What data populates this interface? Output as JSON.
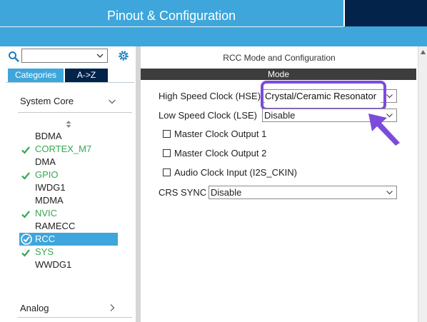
{
  "header": {
    "title": "Pinout & Configuration"
  },
  "left_panel": {
    "search": {
      "value": "",
      "placeholder": ""
    },
    "tabs": [
      {
        "label": "Categories",
        "active": true
      },
      {
        "label": "A->Z",
        "active": false
      }
    ],
    "sections": [
      {
        "label": "System Core",
        "expanded": true
      },
      {
        "label": "Analog",
        "expanded": false
      }
    ],
    "items": [
      {
        "label": "BDMA",
        "status": "none",
        "selected": false
      },
      {
        "label": "CORTEX_M7",
        "status": "ok",
        "selected": false
      },
      {
        "label": "DMA",
        "status": "none",
        "selected": false
      },
      {
        "label": "GPIO",
        "status": "ok",
        "selected": false
      },
      {
        "label": "IWDG1",
        "status": "none",
        "selected": false
      },
      {
        "label": "MDMA",
        "status": "none",
        "selected": false
      },
      {
        "label": "NVIC",
        "status": "ok",
        "selected": false
      },
      {
        "label": "RAMECC",
        "status": "none",
        "selected": false
      },
      {
        "label": "RCC",
        "status": "ok",
        "selected": true
      },
      {
        "label": "SYS",
        "status": "ok",
        "selected": false
      },
      {
        "label": "WWDG1",
        "status": "none",
        "selected": false
      }
    ]
  },
  "right_panel": {
    "title": "RCC Mode and Configuration",
    "mode_label": "Mode",
    "hse": {
      "label": "High Speed Clock (HSE)",
      "value": "Crystal/Ceramic Resonator"
    },
    "lse": {
      "label": "Low Speed Clock (LSE)",
      "value": "Disable"
    },
    "checkboxes": [
      {
        "label": "Master Clock Output 1",
        "checked": false
      },
      {
        "label": "Master Clock Output 2",
        "checked": false
      },
      {
        "label": "Audio Clock Input (I2S_CKIN)",
        "checked": false
      }
    ],
    "crs": {
      "label": "CRS SYNC",
      "value": "Disable"
    }
  },
  "colors": {
    "header_blue": "#3ea6db",
    "header_dark": "#03234b",
    "ok_green": "#34a853",
    "highlight_purple": "#7d4bdc",
    "mode_bar": "#3d3d3d"
  },
  "icons": {
    "search": "search-icon",
    "settings": "gear-icon",
    "dropdown": "chevron-down-icon",
    "collapse": "chevron-down-icon",
    "expand": "chevron-right-icon",
    "sort": "sort-icon",
    "status_ok": "check-icon",
    "status_selected": "check-circle-icon",
    "pointer": "arrow-pointer-icon"
  }
}
